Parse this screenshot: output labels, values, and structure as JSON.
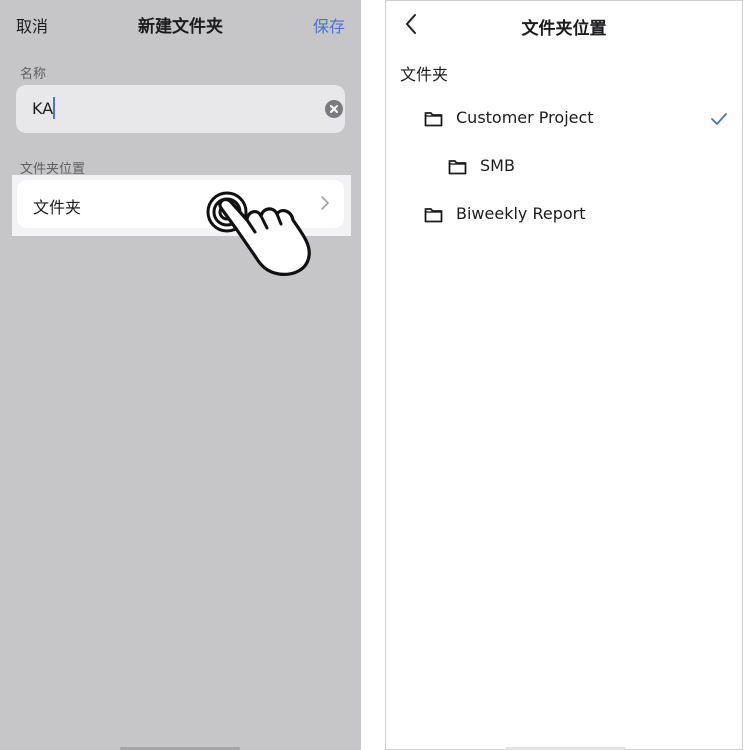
{
  "left_panel": {
    "nav": {
      "cancel_label": "取消",
      "title": "新建文件夹",
      "save_label": "保存"
    },
    "name_section": {
      "label": "名称",
      "value": "KA"
    },
    "location_section": {
      "label": "文件夹位置",
      "folder_row_label": "文件夹"
    }
  },
  "right_panel": {
    "title": "文件夹位置",
    "root_label": "文件夹",
    "folders": [
      {
        "name": "Customer Project",
        "selected": true
      },
      {
        "name": "SMB",
        "selected": false
      },
      {
        "name": "Biweekly Report",
        "selected": false
      }
    ]
  },
  "colors": {
    "accent": "#4a74c9",
    "panel_gray": "#c6c6c8"
  },
  "icons": [
    "clear-icon",
    "chevron-right-icon",
    "pointing-hand-icon",
    "back-arrow-icon",
    "folder-icon",
    "checkmark-icon"
  ]
}
